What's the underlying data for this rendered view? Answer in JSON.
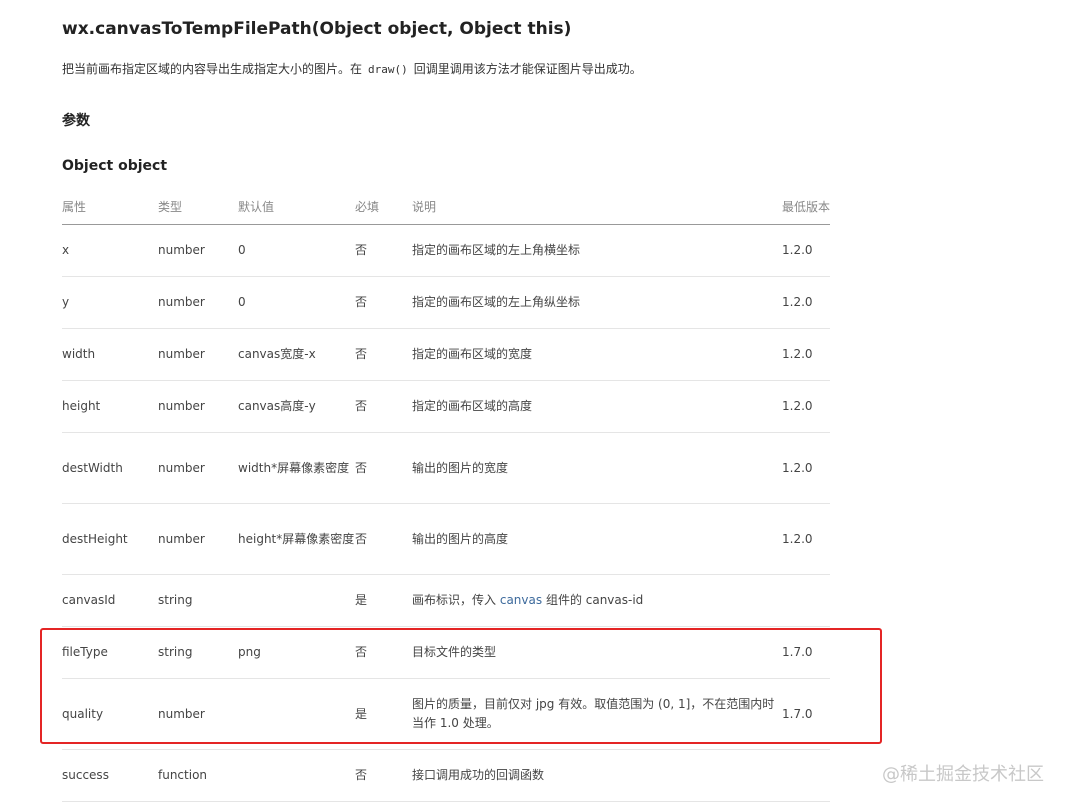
{
  "title": "wx.canvasToTempFilePath(Object object, Object this)",
  "description": {
    "before": "把当前画布指定区域的内容导出生成指定大小的图片。在",
    "code": "draw()",
    "after": "回调里调用该方法才能保证图片导出成功。"
  },
  "params_heading": "参数",
  "object_heading": "Object object",
  "table": {
    "headers": {
      "name": "属性",
      "type": "类型",
      "default": "默认值",
      "required": "必填",
      "desc": "说明",
      "version": "最低版本"
    },
    "rows": [
      {
        "name": "x",
        "type": "number",
        "default": "0",
        "required": "否",
        "desc": "指定的画布区域的左上角横坐标",
        "version": "1.2.0"
      },
      {
        "name": "y",
        "type": "number",
        "default": "0",
        "required": "否",
        "desc": "指定的画布区域的左上角纵坐标",
        "version": "1.2.0"
      },
      {
        "name": "width",
        "type": "number",
        "default": "canvas宽度-x",
        "required": "否",
        "desc": "指定的画布区域的宽度",
        "version": "1.2.0"
      },
      {
        "name": "height",
        "type": "number",
        "default": "canvas高度-y",
        "required": "否",
        "desc": "指定的画布区域的高度",
        "version": "1.2.0"
      },
      {
        "name": "destWidth",
        "type": "number",
        "default": "width*屏幕像素密度",
        "required": "否",
        "desc": "输出的图片的宽度",
        "version": "1.2.0"
      },
      {
        "name": "destHeight",
        "type": "number",
        "default": "height*屏幕像素密度",
        "required": "否",
        "desc": "输出的图片的高度",
        "version": "1.2.0"
      },
      {
        "name": "canvasId",
        "type": "string",
        "default": "",
        "required": "是",
        "desc_before": "画布标识，传入",
        "desc_link": "canvas",
        "desc_after": "组件的 canvas-id",
        "version": ""
      },
      {
        "name": "fileType",
        "type": "string",
        "default": "png",
        "required": "否",
        "desc": "目标文件的类型",
        "version": "1.7.0"
      },
      {
        "name": "quality",
        "type": "number",
        "default": "",
        "required": "是",
        "desc": "图片的质量，目前仅对 jpg 有效。取值范围为 (0, 1]，不在范围内时当作 1.0 处理。",
        "version": "1.7.0"
      },
      {
        "name": "success",
        "type": "function",
        "default": "",
        "required": "否",
        "desc": "接口调用成功的回调函数",
        "version": ""
      }
    ]
  },
  "highlight_color": "#e42525",
  "watermark": "@稀土掘金技术社区"
}
